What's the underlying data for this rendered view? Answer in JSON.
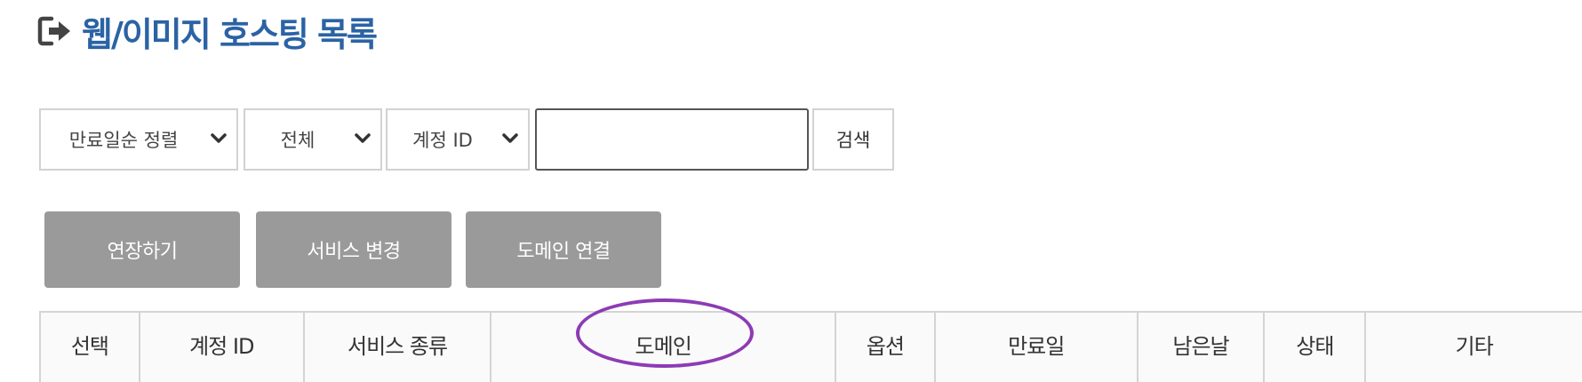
{
  "page": {
    "title": "웹/이미지 호스팅 목록",
    "title_icon": "sign-out-icon",
    "accent_color": "#2b63a4"
  },
  "filters": {
    "sort_select": {
      "value": "만료일순 정렬",
      "icon": "chevron-down-icon"
    },
    "type_select": {
      "value": "전체",
      "icon": "chevron-down-icon"
    },
    "field_select": {
      "value": "계정 ID",
      "icon": "chevron-down-icon"
    },
    "search_input": {
      "value": "",
      "placeholder": ""
    },
    "search_button": "검색"
  },
  "actions": {
    "extend": "연장하기",
    "change_service": "서비스 변경",
    "connect_domain": "도메인 연결",
    "button_color": "#9a9a9a"
  },
  "table": {
    "columns": [
      "선택",
      "계정 ID",
      "서비스 종류",
      "도메인",
      "옵션",
      "만료일",
      "남은날",
      "상태",
      "기타"
    ]
  },
  "annotation": {
    "highlight_color": "#8d3bb5"
  }
}
